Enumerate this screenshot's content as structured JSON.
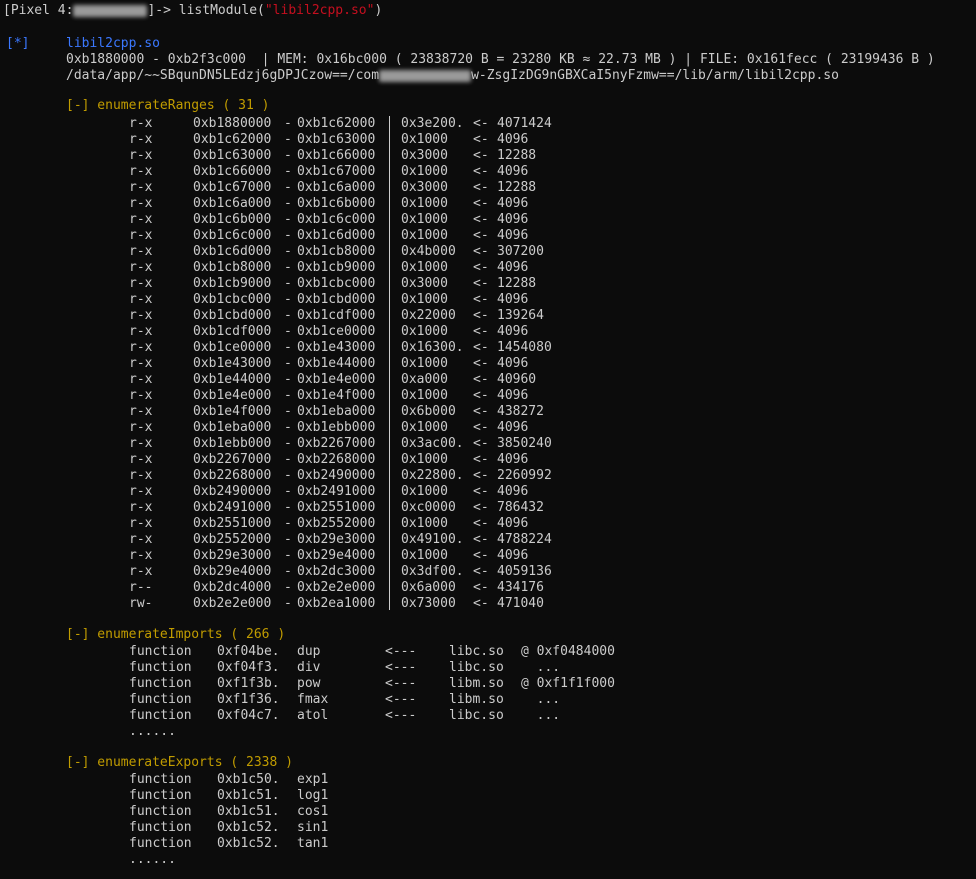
{
  "prompt": {
    "device": "[Pixel 4:",
    "after_device": "]-> listModule(",
    "arg": "\"libil2cpp.so\"",
    "close": ")"
  },
  "module": {
    "marker": "[*]",
    "name": "libil2cpp.so",
    "range_line": "0xb1880000 - 0xb2f3c000  | MEM: 0x16bc000 ( 23838720 B = 23280 KB ≈ 22.73 MB ) | FILE: 0x161fecc ( 23199436 B )",
    "path_prefix": "/data/app/~~SBqunDN5LEdzj6gDPJCzow==/com",
    "path_suffix": "w-ZsgIzDG9nGBXCaI5nyFzmw==/lib/arm/libil2cpp.so"
  },
  "ranges": {
    "header": "[-] enumerateRanges ( 31 )",
    "rows": [
      {
        "prot": "r-x",
        "start": "0xb1880000",
        "end": "0xb1c62000",
        "size": "0x3e200.",
        "dec": "4071424"
      },
      {
        "prot": "r-x",
        "start": "0xb1c62000",
        "end": "0xb1c63000",
        "size": "0x1000",
        "dec": "4096"
      },
      {
        "prot": "r-x",
        "start": "0xb1c63000",
        "end": "0xb1c66000",
        "size": "0x3000",
        "dec": "12288"
      },
      {
        "prot": "r-x",
        "start": "0xb1c66000",
        "end": "0xb1c67000",
        "size": "0x1000",
        "dec": "4096"
      },
      {
        "prot": "r-x",
        "start": "0xb1c67000",
        "end": "0xb1c6a000",
        "size": "0x3000",
        "dec": "12288"
      },
      {
        "prot": "r-x",
        "start": "0xb1c6a000",
        "end": "0xb1c6b000",
        "size": "0x1000",
        "dec": "4096"
      },
      {
        "prot": "r-x",
        "start": "0xb1c6b000",
        "end": "0xb1c6c000",
        "size": "0x1000",
        "dec": "4096"
      },
      {
        "prot": "r-x",
        "start": "0xb1c6c000",
        "end": "0xb1c6d000",
        "size": "0x1000",
        "dec": "4096"
      },
      {
        "prot": "r-x",
        "start": "0xb1c6d000",
        "end": "0xb1cb8000",
        "size": "0x4b000",
        "dec": "307200"
      },
      {
        "prot": "r-x",
        "start": "0xb1cb8000",
        "end": "0xb1cb9000",
        "size": "0x1000",
        "dec": "4096"
      },
      {
        "prot": "r-x",
        "start": "0xb1cb9000",
        "end": "0xb1cbc000",
        "size": "0x3000",
        "dec": "12288"
      },
      {
        "prot": "r-x",
        "start": "0xb1cbc000",
        "end": "0xb1cbd000",
        "size": "0x1000",
        "dec": "4096"
      },
      {
        "prot": "r-x",
        "start": "0xb1cbd000",
        "end": "0xb1cdf000",
        "size": "0x22000",
        "dec": "139264"
      },
      {
        "prot": "r-x",
        "start": "0xb1cdf000",
        "end": "0xb1ce0000",
        "size": "0x1000",
        "dec": "4096"
      },
      {
        "prot": "r-x",
        "start": "0xb1ce0000",
        "end": "0xb1e43000",
        "size": "0x16300.",
        "dec": "1454080"
      },
      {
        "prot": "r-x",
        "start": "0xb1e43000",
        "end": "0xb1e44000",
        "size": "0x1000",
        "dec": "4096"
      },
      {
        "prot": "r-x",
        "start": "0xb1e44000",
        "end": "0xb1e4e000",
        "size": "0xa000",
        "dec": "40960"
      },
      {
        "prot": "r-x",
        "start": "0xb1e4e000",
        "end": "0xb1e4f000",
        "size": "0x1000",
        "dec": "4096"
      },
      {
        "prot": "r-x",
        "start": "0xb1e4f000",
        "end": "0xb1eba000",
        "size": "0x6b000",
        "dec": "438272"
      },
      {
        "prot": "r-x",
        "start": "0xb1eba000",
        "end": "0xb1ebb000",
        "size": "0x1000",
        "dec": "4096"
      },
      {
        "prot": "r-x",
        "start": "0xb1ebb000",
        "end": "0xb2267000",
        "size": "0x3ac00.",
        "dec": "3850240"
      },
      {
        "prot": "r-x",
        "start": "0xb2267000",
        "end": "0xb2268000",
        "size": "0x1000",
        "dec": "4096"
      },
      {
        "prot": "r-x",
        "start": "0xb2268000",
        "end": "0xb2490000",
        "size": "0x22800.",
        "dec": "2260992"
      },
      {
        "prot": "r-x",
        "start": "0xb2490000",
        "end": "0xb2491000",
        "size": "0x1000",
        "dec": "4096"
      },
      {
        "prot": "r-x",
        "start": "0xb2491000",
        "end": "0xb2551000",
        "size": "0xc0000",
        "dec": "786432"
      },
      {
        "prot": "r-x",
        "start": "0xb2551000",
        "end": "0xb2552000",
        "size": "0x1000",
        "dec": "4096"
      },
      {
        "prot": "r-x",
        "start": "0xb2552000",
        "end": "0xb29e3000",
        "size": "0x49100.",
        "dec": "4788224"
      },
      {
        "prot": "r-x",
        "start": "0xb29e3000",
        "end": "0xb29e4000",
        "size": "0x1000",
        "dec": "4096"
      },
      {
        "prot": "r-x",
        "start": "0xb29e4000",
        "end": "0xb2dc3000",
        "size": "0x3df00.",
        "dec": "4059136"
      },
      {
        "prot": "r--",
        "start": "0xb2dc4000",
        "end": "0xb2e2e000",
        "size": "0x6a000",
        "dec": "434176"
      },
      {
        "prot": "rw-",
        "start": "0xb2e2e000",
        "end": "0xb2ea1000",
        "size": "0x73000",
        "dec": "471040"
      }
    ]
  },
  "imports": {
    "header": "[-] enumerateImports ( 266 )",
    "rows": [
      {
        "type": "function",
        "addr": "0xf04be.",
        "name": "dup",
        "arrow": "<---",
        "lib": "libc.so",
        "base": "@ 0xf0484000"
      },
      {
        "type": "function",
        "addr": "0xf04f3.",
        "name": "div",
        "arrow": "<---",
        "lib": "libc.so",
        "base": "  ..."
      },
      {
        "type": "function",
        "addr": "0xf1f3b.",
        "name": "pow",
        "arrow": "<---",
        "lib": "libm.so",
        "base": "@ 0xf1f1f000"
      },
      {
        "type": "function",
        "addr": "0xf1f36.",
        "name": "fmax",
        "arrow": "<---",
        "lib": "libm.so",
        "base": "  ..."
      },
      {
        "type": "function",
        "addr": "0xf04c7.",
        "name": "atol",
        "arrow": "<---",
        "lib": "libc.so",
        "base": "  ..."
      }
    ],
    "ellipsis": "......"
  },
  "exports": {
    "header": "[-] enumerateExports ( 2338 )",
    "rows": [
      {
        "type": "function",
        "addr": "0xb1c50.",
        "name": "exp1"
      },
      {
        "type": "function",
        "addr": "0xb1c51.",
        "name": "log1"
      },
      {
        "type": "function",
        "addr": "0xb1c51.",
        "name": "cos1"
      },
      {
        "type": "function",
        "addr": "0xb1c52.",
        "name": "sin1"
      },
      {
        "type": "function",
        "addr": "0xb1c52.",
        "name": "tan1"
      }
    ],
    "ellipsis": "......"
  },
  "colors": {
    "background": "#0c0c0c",
    "text": "#cccccc",
    "accent_blue": "#3b78ff",
    "accent_yellow": "#c19c00",
    "accent_red": "#c50f1f"
  }
}
